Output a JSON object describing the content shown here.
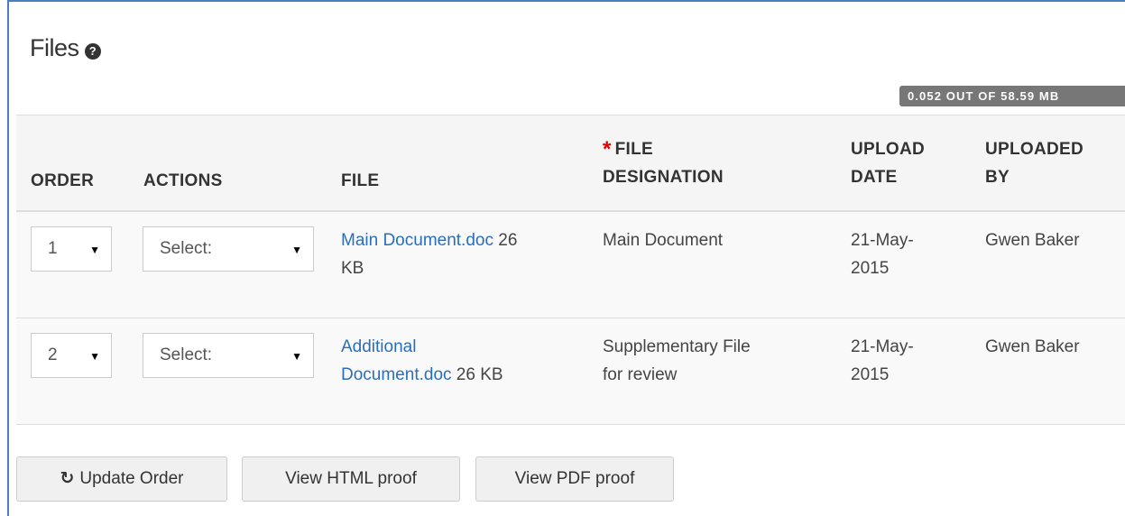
{
  "section": {
    "title": "Files",
    "help_icon": "question-circle-icon",
    "quota": "0.052 OUT OF 58.59 MB"
  },
  "table": {
    "headers": {
      "order": "ORDER",
      "actions": "ACTIONS",
      "file": "FILE",
      "designation_required": "*",
      "designation_l1": "FILE",
      "designation_l2": "DESIGNATION",
      "upload_date_l1": "UPLOAD",
      "upload_date_l2": "DATE",
      "uploaded_by_l1": "UPLOADED",
      "uploaded_by_l2": "BY"
    },
    "rows": [
      {
        "order": "1",
        "actions": "Select:",
        "file_name_l1": "Main Document.doc",
        "file_size_l1": "26",
        "file_name_l2": "",
        "file_size_l2": "KB",
        "designation_l1": "Main Document",
        "designation_l2": "",
        "date_l1": "21-May-",
        "date_l2": "2015",
        "uploaded_by": "Gwen Baker"
      },
      {
        "order": "2",
        "actions": "Select:",
        "file_name_l1": "Additional",
        "file_size_l1": "",
        "file_name_l2": "Document.doc",
        "file_size_l2": "26 KB",
        "designation_l1": "Supplementary File",
        "designation_l2": "for review",
        "date_l1": "21-May-",
        "date_l2": "2015",
        "uploaded_by": "Gwen Baker"
      }
    ]
  },
  "buttons": {
    "update_order": "Update Order",
    "update_order_icon": "refresh-icon",
    "view_html": "View HTML proof",
    "view_pdf": "View PDF proof"
  }
}
